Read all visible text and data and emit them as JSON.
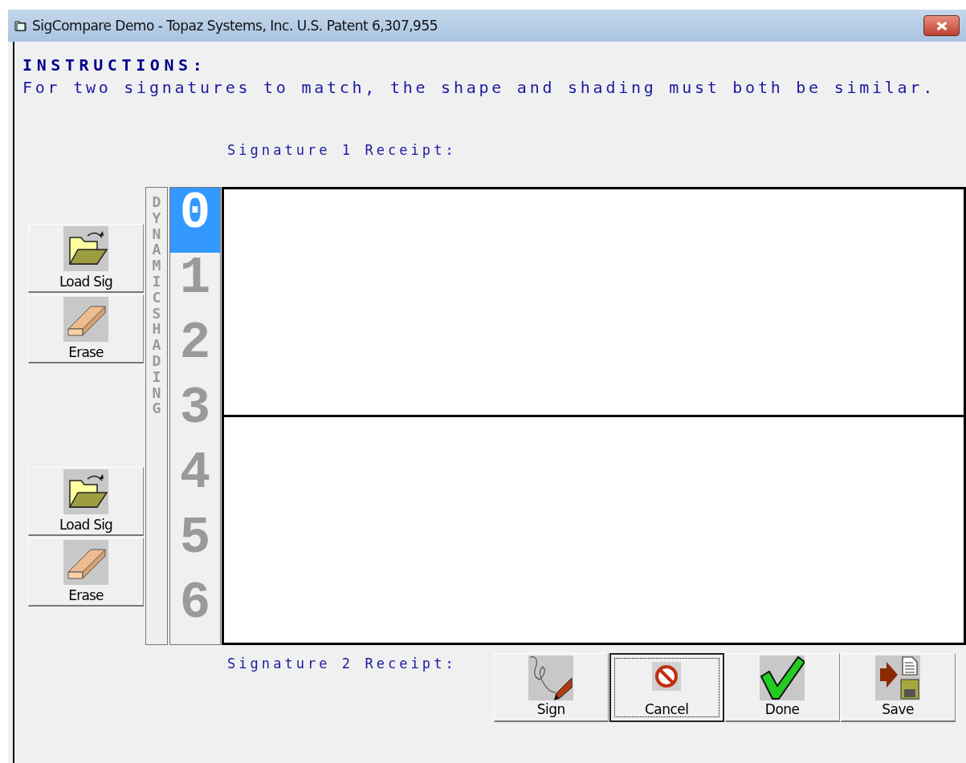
{
  "window": {
    "title": "SigCompare Demo - Topaz Systems, Inc.  U.S. Patent 6,307,955"
  },
  "instructions": {
    "heading": "INSTRUCTIONS:",
    "text": "For two signatures to match, the shape and shading must both be similar."
  },
  "signature_1_label": "Signature 1 Receipt:",
  "signature_2_label": "Signature 2 Receipt:",
  "side_buttons": [
    {
      "kind": "load",
      "label": "Load Sig"
    },
    {
      "kind": "erase",
      "label": "Erase"
    },
    {
      "kind": "load",
      "label": "Load Sig"
    },
    {
      "kind": "erase",
      "label": "Erase"
    }
  ],
  "shading_caption": "DYNAMIC SHADING",
  "shading_levels": [
    {
      "label": "0",
      "selected": true
    },
    {
      "label": "1",
      "selected": false
    },
    {
      "label": "2",
      "selected": false
    },
    {
      "label": "3",
      "selected": false
    },
    {
      "label": "4",
      "selected": false
    },
    {
      "label": "5",
      "selected": false
    },
    {
      "label": "6",
      "selected": false
    }
  ],
  "action_buttons": [
    {
      "kind": "sign",
      "label": "Sign",
      "focused": false
    },
    {
      "kind": "cancel",
      "label": "Cancel",
      "focused": true
    },
    {
      "kind": "done",
      "label": "Done",
      "focused": false
    },
    {
      "kind": "save",
      "label": "Save",
      "focused": false
    }
  ]
}
